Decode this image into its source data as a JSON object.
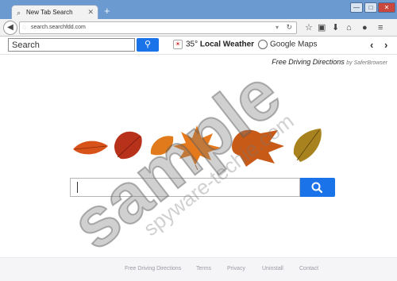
{
  "browser": {
    "tab_title": "New Tab Search",
    "new_tab_symbol": "+",
    "url": "search.searchfdd.com",
    "window_minimize": "—",
    "window_maximize": "□",
    "window_close": "✕"
  },
  "toolbar": {
    "search_placeholder": "Search",
    "weather_temp": "35°",
    "weather_label": "Local Weather",
    "maps_label": "Google Maps",
    "prev_symbol": "‹",
    "next_symbol": "›"
  },
  "page": {
    "brand_title": "Free Driving Directions",
    "brand_by": "by SaferBrowser",
    "footer_links": [
      "Free Driving Directions",
      "Terms",
      "Privacy",
      "Uninstall",
      "Contact"
    ]
  },
  "watermark": {
    "main": "sample",
    "site": "spyware-techie.com"
  },
  "colors": {
    "accent": "#1a73e8",
    "titlebar": "#6b9ad1"
  }
}
